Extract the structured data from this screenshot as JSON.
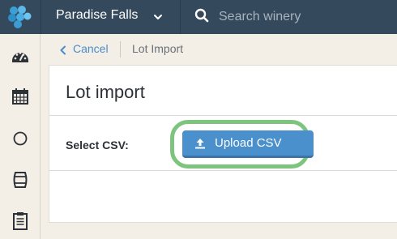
{
  "topbar": {
    "winery_name": "Paradise Falls",
    "search_placeholder": "Search winery"
  },
  "sidebar": {
    "items": [
      {
        "icon": "dashboard-gauge-icon"
      },
      {
        "icon": "calendar-icon"
      },
      {
        "icon": "circle-icon"
      },
      {
        "icon": "barrel-icon"
      },
      {
        "icon": "clipboard-icon"
      }
    ]
  },
  "breadcrumb": {
    "cancel_label": "Cancel",
    "current_label": "Lot Import"
  },
  "main": {
    "title": "Lot import",
    "select_csv_label": "Select CSV:",
    "upload_button_label": "Upload CSV"
  },
  "colors": {
    "topbar": "#35495d",
    "accent": "#4a90cc",
    "highlight": "#7dc47e",
    "background": "#f3efe7"
  }
}
